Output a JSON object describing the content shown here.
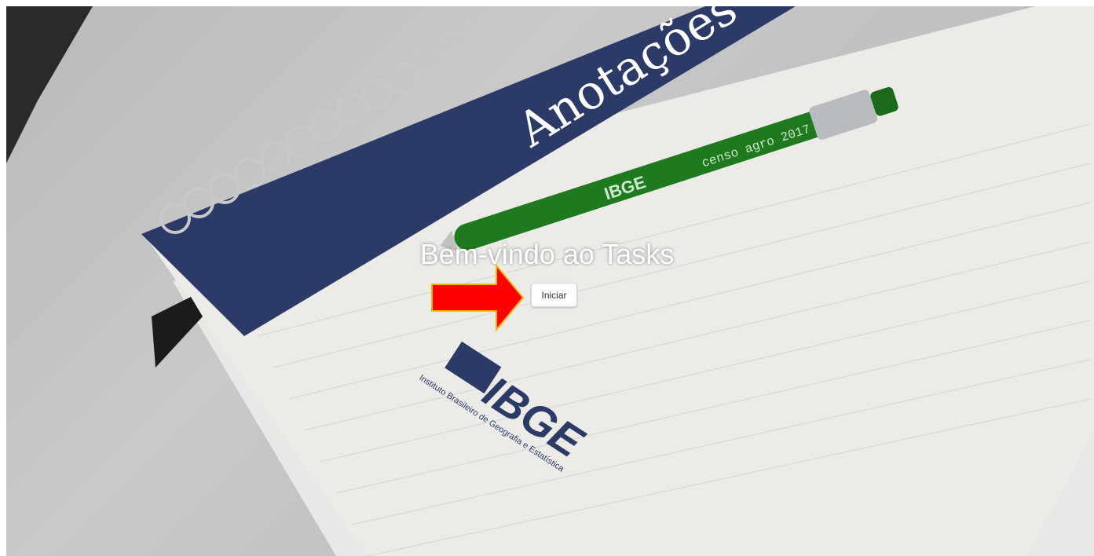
{
  "page": {
    "title": "Bem-vindo ao Tasks",
    "start_button_label": "Iniciar"
  },
  "background_photo": {
    "cover_text": "Anotações",
    "logo_text": "IBGE",
    "logo_subtitle": "Instituto Brasileiro de Geografia e Estatística",
    "pen_brand": "IBGE",
    "pen_text": "censo agro 2017"
  },
  "colors": {
    "title": "#ffffff",
    "arrow_fill": "#ff0000",
    "arrow_stroke": "#f5b800",
    "button_bg": "#ffffff",
    "notebook_cover": "#2b3a66",
    "pen": "#1f7a1f"
  }
}
